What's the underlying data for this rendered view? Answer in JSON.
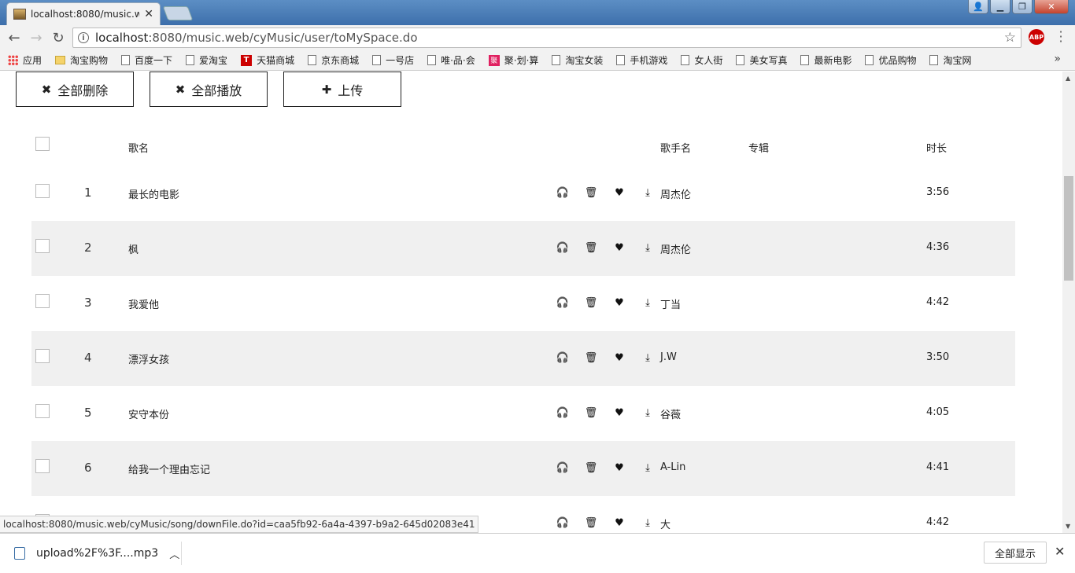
{
  "browser": {
    "tab_title": "localhost:8080/music.w",
    "url_host": "localhost",
    "url_rest": ":8080/music.web/cyMusic/user/toMySpace.do",
    "abp_label": "ABP"
  },
  "bookmarks": [
    {
      "label": "应用",
      "icon": "apps-grid-icon"
    },
    {
      "label": "淘宝购物",
      "icon": "folder-icon"
    },
    {
      "label": "百度一下",
      "icon": "page-icon"
    },
    {
      "label": "爱淘宝",
      "icon": "page-icon"
    },
    {
      "label": "天猫商城",
      "icon": "tmall-icon"
    },
    {
      "label": "京东商城",
      "icon": "page-icon"
    },
    {
      "label": "一号店",
      "icon": "page-icon"
    },
    {
      "label": "唯·品·会",
      "icon": "page-icon"
    },
    {
      "label": "聚·划·算",
      "icon": "ju-icon"
    },
    {
      "label": "淘宝女装",
      "icon": "page-icon"
    },
    {
      "label": "手机游戏",
      "icon": "page-icon"
    },
    {
      "label": "女人街",
      "icon": "page-icon"
    },
    {
      "label": "美女写真",
      "icon": "page-icon"
    },
    {
      "label": "最新电影",
      "icon": "page-icon"
    },
    {
      "label": "优品购物",
      "icon": "page-icon"
    },
    {
      "label": "淘宝网",
      "icon": "page-icon"
    }
  ],
  "actions": {
    "delete_all": "全部删除",
    "play_all": "全部播放",
    "upload": "上传"
  },
  "table": {
    "headers": {
      "name": "歌名",
      "singer": "歌手名",
      "album": "专辑",
      "duration": "时长"
    },
    "rows": [
      {
        "num": "1",
        "name": "最长的电影",
        "singer": "周杰伦",
        "duration": "3:56"
      },
      {
        "num": "2",
        "name": "枫",
        "singer": "周杰伦",
        "duration": "4:36"
      },
      {
        "num": "3",
        "name": "我爱他",
        "singer": "丁当",
        "duration": "4:42"
      },
      {
        "num": "4",
        "name": "漂浮女孩",
        "singer": "J.W",
        "duration": "3:50"
      },
      {
        "num": "5",
        "name": "安守本份",
        "singer": "谷薇",
        "duration": "4:05"
      },
      {
        "num": "6",
        "name": "给我一个理由忘记",
        "singer": "A-Lin",
        "duration": "4:41"
      },
      {
        "num": "",
        "name": "",
        "singer": "大",
        "duration": "4:42"
      }
    ]
  },
  "status_url": "localhost:8080/music.web/cyMusic/song/downFile.do?id=caa5fb92-6a4a-4397-b9a2-645d02083e41",
  "download_shelf": {
    "file_name": "upload%2F%3F....mp3",
    "show_all": "全部显示"
  }
}
